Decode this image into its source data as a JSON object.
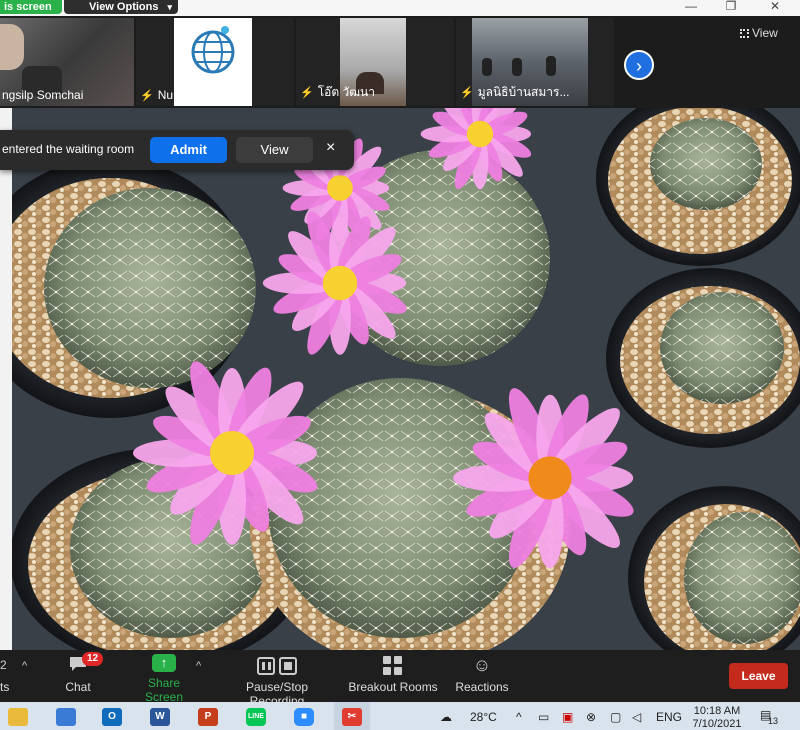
{
  "topbar": {
    "share_label": "is screen",
    "view_options_label": "View Options",
    "caret": "▾",
    "minimize_glyph": "—",
    "restore_glyph": "❐",
    "close_glyph": "✕"
  },
  "participants": [
    {
      "name": "ngsilp Somchai",
      "muted": false
    },
    {
      "name": "NuNu WFH H...",
      "muted": true
    },
    {
      "name": "โอ๊ต วัฒนา",
      "muted": true
    },
    {
      "name": "มูลนิธิบ้านสมาร...",
      "muted": true
    }
  ],
  "strip": {
    "mute_glyph": "⚡",
    "next_glyph": "›",
    "view_label": "View"
  },
  "waiting_room": {
    "message": "entered the waiting room",
    "admit_label": "Admit",
    "view_label": "View",
    "close_glyph": "×"
  },
  "controls": {
    "left_stub_number": "2",
    "left_stub_text": "ts",
    "caret_up": "^",
    "chat_label": "Chat",
    "chat_badge": "12",
    "share_label": "Share Screen",
    "share_glyph": "↑",
    "record_label": "Pause/Stop Recording",
    "breakout_label": "Breakout Rooms",
    "reactions_label": "Reactions",
    "reactions_glyph": "☺",
    "leave_label": "Leave"
  },
  "taskbar": {
    "apps": [
      {
        "name": "file-explorer",
        "color": "#e8b93a",
        "glyph": ""
      },
      {
        "name": "store",
        "color": "#3a7bd5",
        "glyph": ""
      },
      {
        "name": "outlook",
        "color": "#0f6cbd",
        "glyph": "O"
      },
      {
        "name": "word",
        "color": "#2b579a",
        "glyph": "W"
      },
      {
        "name": "powerpoint",
        "color": "#c43e1c",
        "glyph": "P"
      },
      {
        "name": "line",
        "color": "#06c755",
        "glyph": "LINE"
      },
      {
        "name": "zoom",
        "color": "#2d8cff",
        "glyph": "■"
      },
      {
        "name": "snipping",
        "color": "#e03c31",
        "glyph": "✂"
      }
    ],
    "weather_temp": "28°C",
    "tray_caret": "^",
    "language": "ENG",
    "time": "10:18 AM",
    "date": "7/10/2021",
    "notification_count": "13"
  },
  "colors": {
    "zoom_blue": "#0e71eb",
    "share_green": "#2bb14a",
    "leave_red": "#c42b1c",
    "flower_pink": "#ee7fe0"
  }
}
